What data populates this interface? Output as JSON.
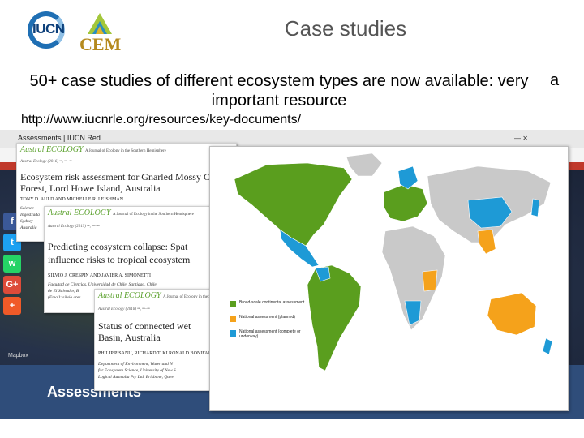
{
  "header": {
    "title": "Case studies",
    "logo_iucn": "IUCN",
    "logo_cem": "CEM"
  },
  "body": {
    "main_text": "50+ case studies of different ecosystem types are now available: very important resource",
    "trailing_letter": "a",
    "url": "http://www.iucnrle.org/resources/key-documents/"
  },
  "background_screenshot": {
    "tab_label": "Assessments | IUCN Red",
    "banner_label": "Assessments",
    "map_credit": "Mapbox",
    "social_icons": [
      {
        "glyph": "f",
        "color": "#3b5998",
        "icon": "facebook-icon"
      },
      {
        "glyph": "t",
        "color": "#1da1f2",
        "icon": "twitter-icon"
      },
      {
        "glyph": "w",
        "color": "#25d366",
        "icon": "whatsapp-icon"
      },
      {
        "glyph": "G+",
        "color": "#dd4b39",
        "icon": "google-plus-icon"
      },
      {
        "glyph": "+",
        "color": "#f05a28",
        "icon": "share-plus-icon"
      }
    ]
  },
  "papers": [
    {
      "journal": "Austral ECOLOGY",
      "journal_sub": "A Journal of Ecology in the Southern Hemisphere",
      "citation": "Austral Ecology (2016) ••, ••–••",
      "title_lines": [
        "Ecosystem risk assessment for Gnarled Mossy Clo",
        "Forest, Lord Howe Island, Australia"
      ],
      "authors": "TONY D. AULD AND MICHELLE R. LEISHMAN",
      "affil_lines": [
        "Science",
        "Ingestrada",
        "Sydney",
        "Australia"
      ]
    },
    {
      "journal": "Austral ECOLOGY",
      "journal_sub": "A Journal of Ecology in the Southern Hemisphere",
      "citation": "Austral Ecology (2015) ••, ••–••",
      "title_lines": [
        "Predicting ecosystem collapse: Spat",
        "influence risks to tropical ecosystem"
      ],
      "authors": "SILVIO J. CRESPIN AND JAVIER A. SIMONETTI",
      "affil_lines": [
        "Facultad de Ciencias, Universidad de Chile, Santiago, Chile",
        "de El Salvador, B",
        "(Email: silvio.cres"
      ]
    },
    {
      "journal": "Austral ECOLOGY",
      "journal_sub": "A Journal of Ecology in the Southern Hemisphere",
      "citation": "Austral Ecology (2016) ••, ••–••",
      "title_lines": [
        "Status of connected wet",
        "Basin, Australia"
      ],
      "authors": "PHILIP PISANU, RICHARD T. KI RONALD BONIFACIO",
      "affil_lines": [
        "Department of Environment, Water and N",
        "for Ecosystem Science, University of New S",
        "Logical Australia Pty Ltd, Brisbane, Quee"
      ]
    }
  ],
  "map_legend": [
    {
      "label": "Broad-scale continental assessment",
      "color": "#5a9e1e"
    },
    {
      "label": "National assessment (planned)",
      "color": "#f5a21b"
    },
    {
      "label": "National assessment (complete or underway)",
      "color": "#1e9ad6"
    }
  ]
}
